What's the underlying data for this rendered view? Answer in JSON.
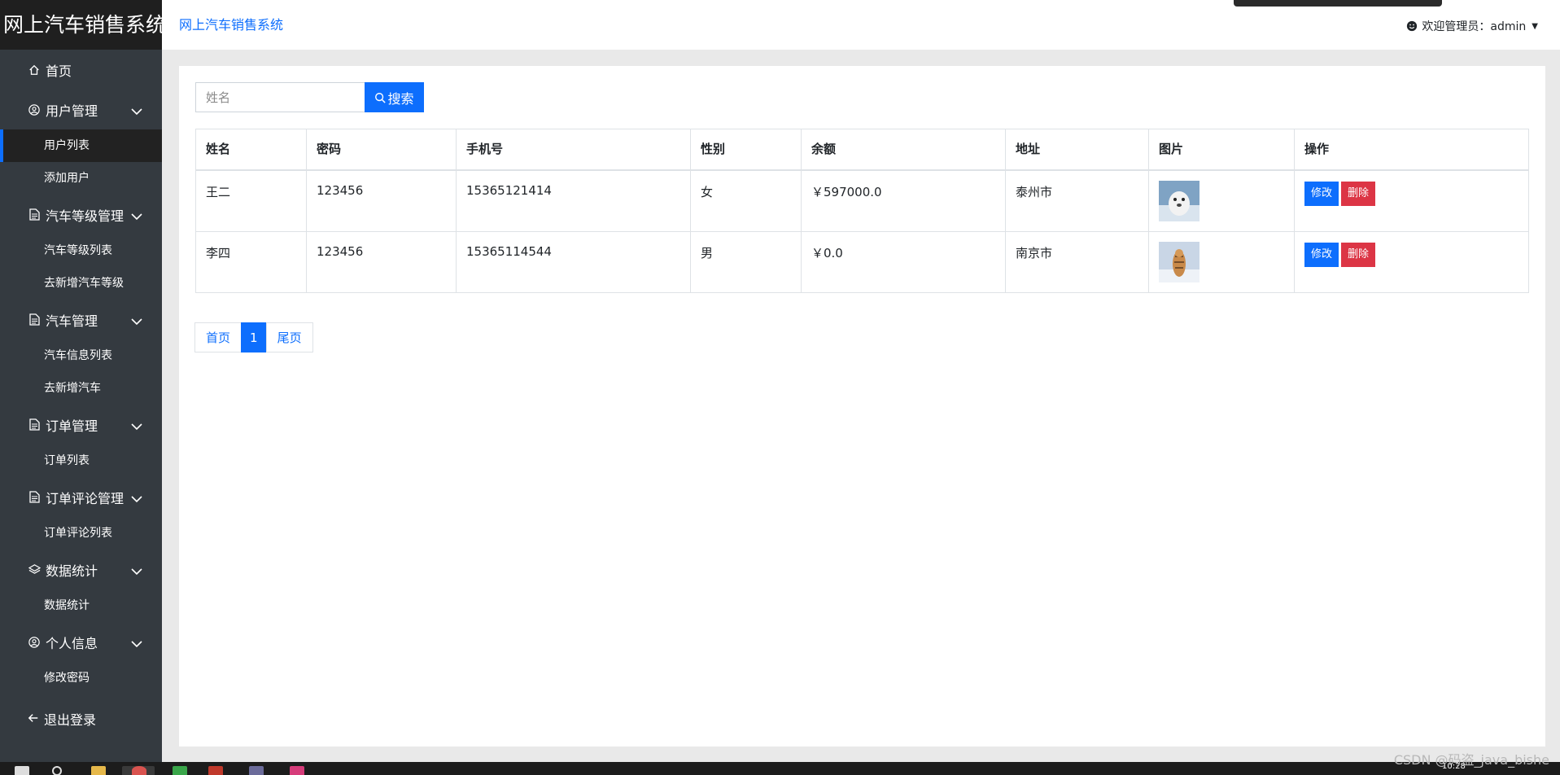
{
  "sidebar": {
    "brand": "网上汽车销售系统",
    "home": "首页",
    "groups": [
      {
        "label": "用户管理",
        "icon": "user-circle-icon",
        "items": [
          "用户列表",
          "添加用户"
        ]
      },
      {
        "label": "汽车等级管理",
        "icon": "document-icon",
        "items": [
          "汽车等级列表",
          "去新增汽车等级"
        ]
      },
      {
        "label": "汽车管理",
        "icon": "document-icon",
        "items": [
          "汽车信息列表",
          "去新增汽车"
        ]
      },
      {
        "label": "订单管理",
        "icon": "document-icon",
        "items": [
          "订单列表"
        ]
      },
      {
        "label": "订单评论管理",
        "icon": "document-icon",
        "items": [
          "订单评论列表"
        ]
      },
      {
        "label": "数据统计",
        "icon": "layers-icon",
        "items": [
          "数据统计"
        ]
      },
      {
        "label": "个人信息",
        "icon": "user-circle-icon",
        "items": [
          "修改密码"
        ]
      }
    ],
    "logout": "退出登录"
  },
  "header": {
    "title_link": "网上汽车销售系统",
    "welcome": "欢迎管理员：admin"
  },
  "search": {
    "placeholder": "姓名",
    "button_label": "搜索"
  },
  "table": {
    "columns": [
      "姓名",
      "密码",
      "手机号",
      "性别",
      "余额",
      "地址",
      "图片",
      "操作"
    ],
    "rows": [
      {
        "name": "王二",
        "password": "123456",
        "phone": "15365121414",
        "gender": "女",
        "balance": "￥597000.0",
        "address": "泰州市",
        "image": "seal-photo"
      },
      {
        "name": "李四",
        "password": "123456",
        "phone": "15365114544",
        "gender": "男",
        "balance": "￥0.0",
        "address": "南京市",
        "image": "tiger-photo"
      }
    ],
    "edit_label": "修改",
    "delete_label": "删除"
  },
  "pagination": {
    "first": "首页",
    "current": "1",
    "last": "尾页"
  },
  "watermark": "CSDN @码盗_java_bishe",
  "taskbar": {
    "clock": "10:28"
  },
  "colors": {
    "primary": "#0d6efd",
    "danger": "#dc3545",
    "sidebar": "#343a40",
    "brand_bg": "#1f1f1f"
  }
}
